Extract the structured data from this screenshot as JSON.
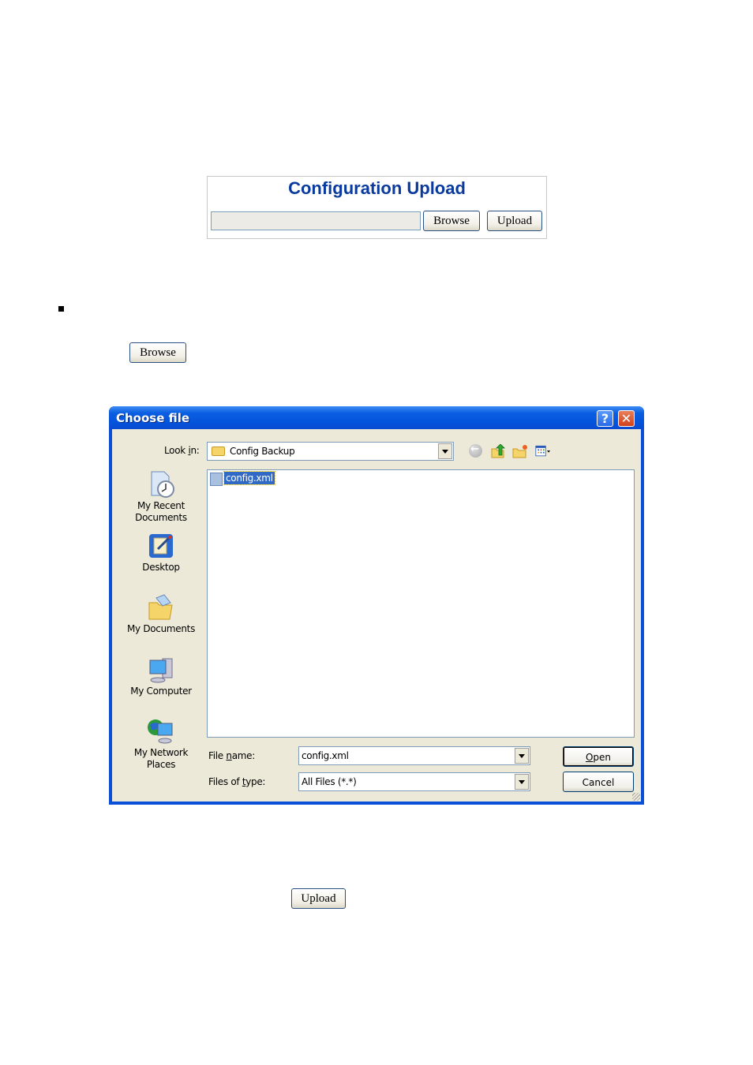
{
  "upload_panel": {
    "title": "Configuration Upload",
    "file_path_value": "",
    "browse_label": "Browse",
    "upload_label": "Upload"
  },
  "steps": {
    "browse_button_label": "Browse",
    "upload_button_label": "Upload"
  },
  "dialog": {
    "title": "Choose file",
    "help_glyph": "?",
    "close_glyph": "✕",
    "look_in_label": "Look in:",
    "look_in_value": "Config Backup",
    "toolbar_icons": [
      "back-icon",
      "up-folder-icon",
      "new-folder-icon",
      "views-menu-icon"
    ],
    "places": [
      {
        "label": "My Recent Documents",
        "icon": "recent-documents-icon"
      },
      {
        "label": "Desktop",
        "icon": "desktop-icon"
      },
      {
        "label": "My Documents",
        "icon": "my-documents-icon"
      },
      {
        "label": "My Computer",
        "icon": "my-computer-icon"
      },
      {
        "label": "My Network Places",
        "icon": "network-places-icon"
      }
    ],
    "files": [
      {
        "name": "config.xml",
        "selected": true,
        "icon": "xml-file-icon"
      }
    ],
    "file_name_label": "File name:",
    "file_name_value": "config.xml",
    "file_type_label": "Files of type:",
    "file_type_value": "All Files (*.*)",
    "open_label": "Open",
    "cancel_label": "Cancel"
  },
  "colors": {
    "title_blue": "#0a3a9e",
    "xp_titlebar": "#0554dc",
    "dialog_face": "#ece9d8",
    "selection": "#316ac5"
  }
}
